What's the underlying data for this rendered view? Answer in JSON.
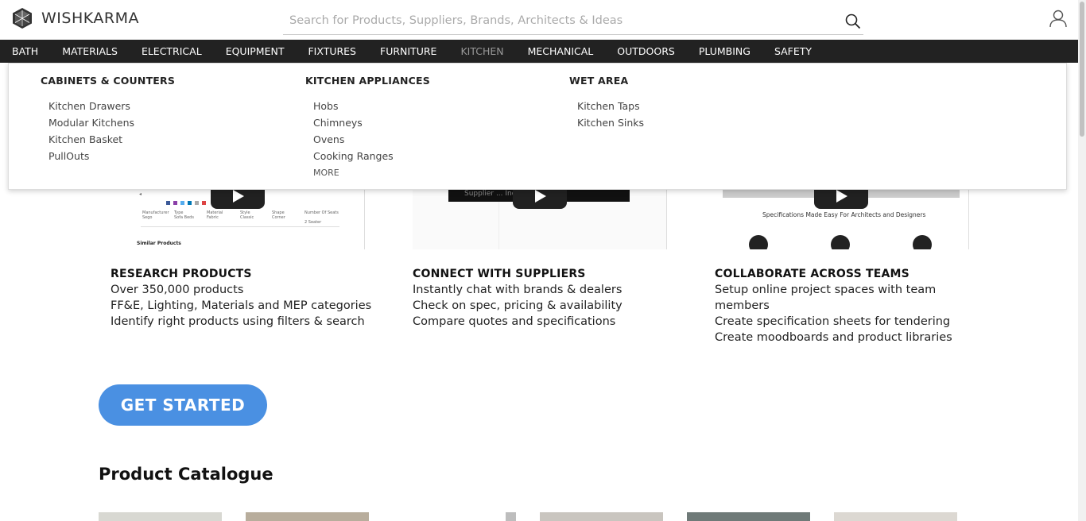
{
  "header": {
    "logo_text": "WISHKARMA",
    "search_placeholder": "Search for Products, Suppliers, Brands, Architects & Ideas"
  },
  "nav": {
    "items": [
      "BATH",
      "MATERIALS",
      "ELECTRICAL",
      "EQUIPMENT",
      "FIXTURES",
      "FURNITURE",
      "KITCHEN",
      "MECHANICAL",
      "OUTDOORS",
      "PLUMBING",
      "SAFETY"
    ],
    "active": "KITCHEN"
  },
  "mega_menu": {
    "columns": [
      {
        "heading": "CABINETS & COUNTERS",
        "links": [
          "Kitchen Drawers",
          "Modular Kitchens",
          "Kitchen Basket",
          "PullOuts"
        ]
      },
      {
        "heading": "KITCHEN APPLIANCES",
        "links": [
          "Hobs",
          "Chimneys",
          "Ovens",
          "Cooking Ranges"
        ],
        "more": "MORE"
      },
      {
        "heading": "WET AREA",
        "links": [
          "Kitchen Taps",
          "Kitchen Sinks"
        ]
      }
    ]
  },
  "thumbs": {
    "thumb1": {
      "headers": [
        "Manufacturer",
        "Type",
        "Material",
        "Style",
        "Shape",
        "Number Of Seats"
      ],
      "values": [
        "Sego",
        "Sofa Beds",
        "Fabric",
        "Classic",
        "Corner",
        "2 Seater"
      ],
      "caption": "Similar Products"
    },
    "thumb2": {
      "banner": "Supplier ... Inquiries"
    },
    "thumb3": {
      "caption": "Specifications Made Easy For Architects and Designers"
    }
  },
  "features": [
    {
      "title": "RESEARCH PRODUCTS",
      "lines": [
        "Over 350,000 products",
        "FF&E, Lighting, Materials and MEP categories",
        "Identify right products using filters & search"
      ]
    },
    {
      "title": "CONNECT WITH SUPPLIERS",
      "lines": [
        "Instantly chat with brands & dealers",
        "Check on spec, pricing & availability",
        "Compare quotes and specifications"
      ]
    },
    {
      "title": "COLLABORATE ACROSS TEAMS",
      "lines": [
        "Setup online project spaces with team",
        "members",
        "Create specification sheets for tendering",
        "Create moodboards and product libraries"
      ]
    }
  ],
  "cta": {
    "label": "GET STARTED"
  },
  "catalogue": {
    "title": "Product Catalogue"
  },
  "colors": {
    "nav_bg": "#222222",
    "cta": "#4a90e2",
    "active_nav": "#999999"
  }
}
